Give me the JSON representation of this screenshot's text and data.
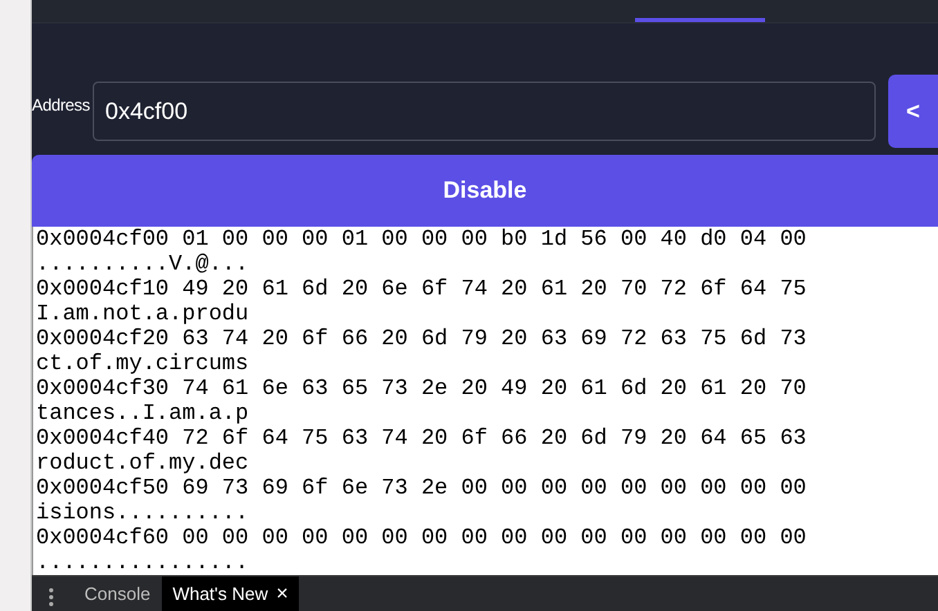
{
  "address": {
    "label": "Address",
    "value": "0x4cf00"
  },
  "back_button": {
    "label": "<"
  },
  "toggle_button": {
    "label": "Disable"
  },
  "hex_rows": [
    {
      "line": "0x0004cf00 01 00 00 00 01 00 00 00 b0 1d 56 00 40 d0 04 00",
      "ascii": "..........V.@..."
    },
    {
      "line": "0x0004cf10 49 20 61 6d 20 6e 6f 74 20 61 20 70 72 6f 64 75",
      "ascii": "I.am.not.a.produ"
    },
    {
      "line": "0x0004cf20 63 74 20 6f 66 20 6d 79 20 63 69 72 63 75 6d 73",
      "ascii": "ct.of.my.circums"
    },
    {
      "line": "0x0004cf30 74 61 6e 63 65 73 2e 20 49 20 61 6d 20 61 20 70",
      "ascii": "tances..I.am.a.p"
    },
    {
      "line": "0x0004cf40 72 6f 64 75 63 74 20 6f 66 20 6d 79 20 64 65 63",
      "ascii": "roduct.of.my.dec"
    },
    {
      "line": "0x0004cf50 69 73 69 6f 6e 73 2e 00 00 00 00 00 00 00 00 00",
      "ascii": "isions.........."
    },
    {
      "line": "0x0004cf60 00 00 00 00 00 00 00 00 00 00 00 00 00 00 00 00",
      "ascii": "................"
    }
  ],
  "drawer_tabs": [
    {
      "label": "Console",
      "selected": false,
      "closable": false
    },
    {
      "label": "What's New",
      "selected": true,
      "closable": true
    }
  ],
  "close_glyph": "×"
}
